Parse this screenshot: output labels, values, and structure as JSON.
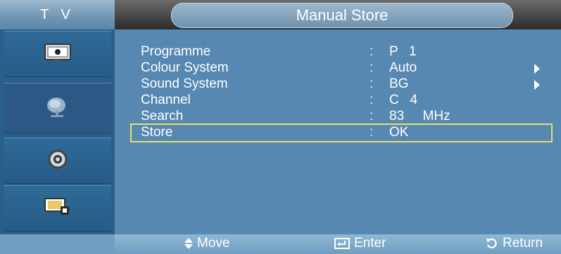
{
  "header": {
    "section_label": "T V",
    "title": "Manual Store"
  },
  "sidebar": {
    "items": [
      {
        "icon": "tv-icon"
      },
      {
        "icon": "satellite-dish-icon"
      },
      {
        "icon": "gear-icon"
      },
      {
        "icon": "input-source-icon"
      }
    ]
  },
  "menu": {
    "rows": [
      {
        "label": "Programme",
        "sep": ":",
        "value": "P   1",
        "has_arrow": false
      },
      {
        "label": "Colour System",
        "sep": ":",
        "value": "Auto",
        "has_arrow": true
      },
      {
        "label": "Sound System",
        "sep": ":",
        "value": "BG",
        "has_arrow": true
      },
      {
        "label": "Channel",
        "sep": ":",
        "value": "C   4",
        "has_arrow": false
      },
      {
        "label": "Search",
        "sep": ":",
        "value": "83     MHz",
        "has_arrow": false
      },
      {
        "label": "Store",
        "sep": ":",
        "value": "OK",
        "has_arrow": false,
        "selected": true
      }
    ]
  },
  "footer": {
    "move_label": "Move",
    "enter_label": "Enter",
    "return_label": "Return"
  },
  "colors": {
    "background": "#5f8fb4",
    "sidebar": "#2a5f8b",
    "content": "#5688b2",
    "selection_border": "#e6e26a"
  }
}
